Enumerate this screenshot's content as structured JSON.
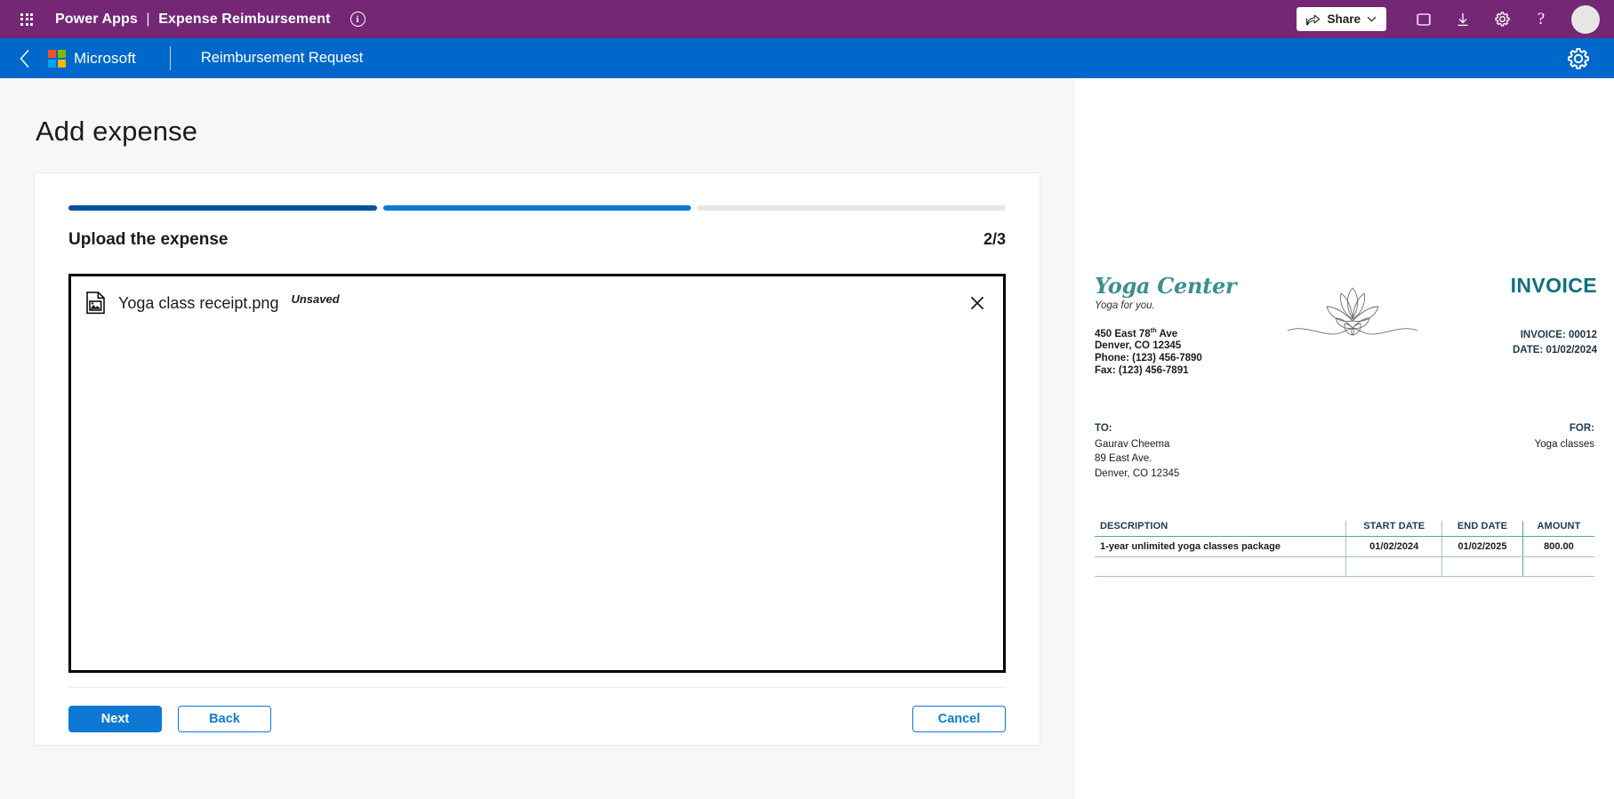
{
  "topbar": {
    "waffle_icon": "app-launcher-icon",
    "product": "Power Apps",
    "separator": "|",
    "app_name": "Expense Reimbursement",
    "info_icon": "i",
    "share_label": "Share",
    "share_icon": "share-icon",
    "chevron_icon": "chevron-down-icon",
    "fullscreen_icon": "fullscreen-icon",
    "download_icon": "download-icon",
    "settings_icon": "gear-icon",
    "help_icon": "?",
    "avatar": "user-avatar",
    "bg_color": "#742774"
  },
  "navbar": {
    "back_icon": "chevron-left-icon",
    "brand": "Microsoft",
    "page_title": "Reimbursement Request",
    "gear_icon": "gear-icon",
    "bg_color": "#0067cb"
  },
  "main": {
    "heading": "Add expense",
    "progress": {
      "segments": [
        "done",
        "active",
        "todo"
      ],
      "done_color": "#01549b",
      "active_color": "#0f77d8",
      "todo_color": "#e7e7e7"
    },
    "step": {
      "title": "Upload the expense",
      "counter": "2/3"
    },
    "file": {
      "icon": "image-file-icon",
      "name": "Yoga class receipt.png",
      "status": "Unsaved",
      "close_icon": "close-icon"
    },
    "buttons": {
      "next": "Next",
      "back": "Back",
      "cancel": "Cancel",
      "accent_color": "#0f78d4"
    }
  },
  "invoice": {
    "brand_name": "Yoga Center",
    "brand_tagline": "Yoga for you.",
    "brand_color": "#3d8f8c",
    "logo_icon": "lotus-flower-icon",
    "address": {
      "street_prefix": "450 East 78",
      "street_sup": "th",
      "street_suffix": " Ave",
      "city": "Denver, CO 12345",
      "phone": "Phone: (123) 456-7890",
      "fax": "Fax: (123) 456-7891"
    },
    "title": "INVOICE",
    "title_color": "#10707c",
    "number_label": "INVOICE:",
    "number_value": "00012",
    "date_label": "DATE:",
    "date_value": "01/02/2024",
    "to_label": "TO:",
    "to_lines": [
      "Gaurav Cheema",
      "89 East Ave.",
      "Denver, CO 12345"
    ],
    "for_label": "FOR:",
    "for_value": "Yoga classes",
    "table": {
      "headers": [
        "DESCRIPTION",
        "START DATE",
        "END DATE",
        "AMOUNT"
      ],
      "rows": [
        [
          "1-year unlimited yoga classes package",
          "01/02/2024",
          "01/02/2025",
          "800.00"
        ]
      ]
    }
  }
}
